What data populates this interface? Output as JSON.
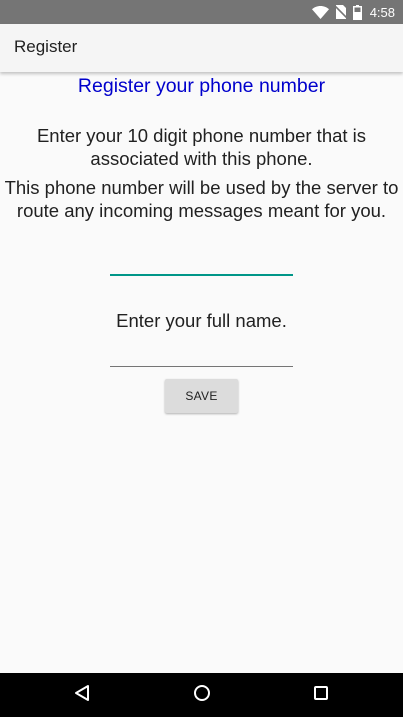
{
  "status_bar": {
    "time": "4:58",
    "icons": [
      "wifi-icon",
      "no-sim-icon",
      "battery-icon"
    ]
  },
  "app_bar": {
    "title": "Register"
  },
  "form": {
    "heading": "Register your phone number",
    "instruction": "Enter your 10 digit phone number that is associated with this phone.",
    "description": "This phone number will be used by the server to route any incoming messages meant for you.",
    "phone_value": "",
    "name_label": "Enter your full name.",
    "name_value": "",
    "save_label": "SAVE"
  },
  "nav_bar": {
    "icons": [
      "back-icon",
      "home-icon",
      "recents-icon"
    ]
  },
  "colors": {
    "status_bar": "#757575",
    "app_bar": "#f5f5f5",
    "heading": "#0000cc",
    "accent": "#009688",
    "button": "#dcdcdc",
    "nav_bar": "#000000"
  }
}
